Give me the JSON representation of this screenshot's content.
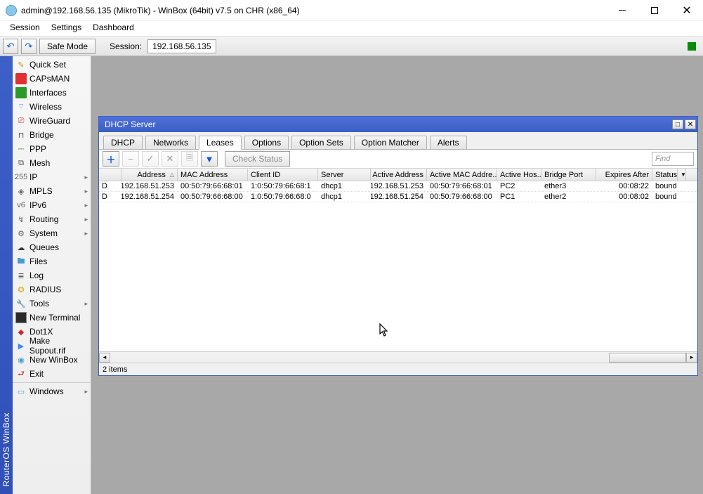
{
  "titlebar": {
    "text": "admin@192.168.56.135 (MikroTik) - WinBox (64bit) v7.5 on CHR (x86_64)"
  },
  "menubar": [
    "Session",
    "Settings",
    "Dashboard"
  ],
  "toolbar": {
    "safe_mode": "Safe Mode",
    "session_label": "Session:",
    "session_value": "192.168.56.135"
  },
  "leftrail": "RouterOS WinBox",
  "sidebar": {
    "items": [
      {
        "label": "Quick Set",
        "icon": "wand-icon",
        "cls": "ic-wand",
        "glyph": "✎"
      },
      {
        "label": "CAPsMAN",
        "icon": "capsman-icon",
        "cls": "ic-caps",
        "glyph": ""
      },
      {
        "label": "Interfaces",
        "icon": "interfaces-icon",
        "cls": "ic-if",
        "glyph": ""
      },
      {
        "label": "Wireless",
        "icon": "wireless-icon",
        "cls": "ic-wifi",
        "glyph": "⌔"
      },
      {
        "label": "WireGuard",
        "icon": "wireguard-icon",
        "cls": "ic-wg",
        "glyph": "⎚"
      },
      {
        "label": "Bridge",
        "icon": "bridge-icon",
        "cls": "ic-bridge",
        "glyph": "⊓"
      },
      {
        "label": "PPP",
        "icon": "ppp-icon",
        "cls": "ic-ppp",
        "glyph": "⎓"
      },
      {
        "label": "Mesh",
        "icon": "mesh-icon",
        "cls": "ic-mesh",
        "glyph": "⧉"
      },
      {
        "label": "IP",
        "icon": "ip-icon",
        "cls": "ic-ip",
        "glyph": "255",
        "arrow": true
      },
      {
        "label": "MPLS",
        "icon": "mpls-icon",
        "cls": "ic-mpls",
        "glyph": "◈",
        "arrow": true
      },
      {
        "label": "IPv6",
        "icon": "ipv6-icon",
        "cls": "ic-ipv6",
        "glyph": "v6",
        "arrow": true
      },
      {
        "label": "Routing",
        "icon": "routing-icon",
        "cls": "ic-route",
        "glyph": "↯",
        "arrow": true
      },
      {
        "label": "System",
        "icon": "system-icon",
        "cls": "ic-sys",
        "glyph": "⚙",
        "arrow": true
      },
      {
        "label": "Queues",
        "icon": "queues-icon",
        "cls": "ic-queue",
        "glyph": "☁"
      },
      {
        "label": "Files",
        "icon": "files-icon",
        "cls": "ic-files",
        "glyph": "🖿"
      },
      {
        "label": "Log",
        "icon": "log-icon",
        "cls": "ic-log",
        "glyph": "≣"
      },
      {
        "label": "RADIUS",
        "icon": "radius-icon",
        "cls": "ic-radius",
        "glyph": "✪"
      },
      {
        "label": "Tools",
        "icon": "tools-icon",
        "cls": "ic-tools",
        "glyph": "🔧",
        "arrow": true
      },
      {
        "label": "New Terminal",
        "icon": "terminal-icon",
        "cls": "ic-term",
        "glyph": ""
      },
      {
        "label": "Dot1X",
        "icon": "dot1x-icon",
        "cls": "ic-dot1x",
        "glyph": "◆"
      },
      {
        "label": "Make Supout.rif",
        "icon": "supout-icon",
        "cls": "ic-supout",
        "glyph": "▶"
      },
      {
        "label": "New WinBox",
        "icon": "newwinbox-icon",
        "cls": "ic-nwb",
        "glyph": "◉"
      },
      {
        "label": "Exit",
        "icon": "exit-icon",
        "cls": "ic-exit",
        "glyph": "⮐"
      }
    ],
    "windows": {
      "label": "Windows",
      "icon": "windows-icon",
      "cls": "ic-win",
      "glyph": "▭"
    }
  },
  "dhcp_window": {
    "title": "DHCP Server",
    "tabs": [
      "DHCP",
      "Networks",
      "Leases",
      "Options",
      "Option Sets",
      "Option Matcher",
      "Alerts"
    ],
    "active_tab": 2,
    "check_status": "Check Status",
    "find_placeholder": "Find",
    "columns": [
      "Address",
      "MAC Address",
      "Client ID",
      "Server",
      "Active Address",
      "Active MAC Addre...",
      "Active Hos...",
      "Bridge Port",
      "Expires After",
      "Status"
    ],
    "rows": [
      {
        "flag": "D",
        "address": "192.168.51.253",
        "mac": "00:50:79:66:68:01",
        "cid": "1:0:50:79:66:68:1",
        "server": "dhcp1",
        "active_addr": "192.168.51.253",
        "active_mac": "00:50:79:66:68:01",
        "active_host": "PC2",
        "bridge_port": "ether3",
        "expires": "00:08:22",
        "status": "bound"
      },
      {
        "flag": "D",
        "address": "192.168.51.254",
        "mac": "00:50:79:66:68:00",
        "cid": "1:0:50:79:66:68:0",
        "server": "dhcp1",
        "active_addr": "192.168.51.254",
        "active_mac": "00:50:79:66:68:00",
        "active_host": "PC1",
        "bridge_port": "ether2",
        "expires": "00:08:02",
        "status": "bound"
      }
    ],
    "status": "2 items"
  }
}
